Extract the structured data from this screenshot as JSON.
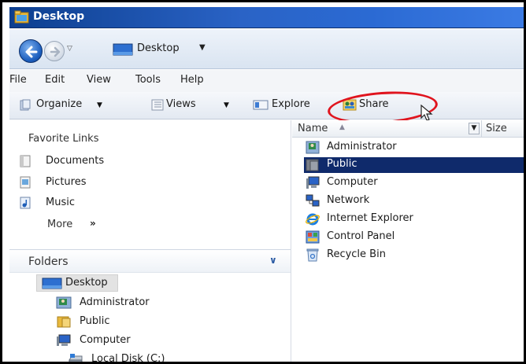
{
  "window": {
    "title": "Desktop"
  },
  "address": {
    "location": "Desktop"
  },
  "menu": [
    "File",
    "Edit",
    "View",
    "Tools",
    "Help"
  ],
  "toolbar": {
    "organize": "Organize",
    "views": "Views",
    "explore": "Explore",
    "share": "Share"
  },
  "favorites": {
    "title": "Favorite Links",
    "items": [
      "Documents",
      "Pictures",
      "Music"
    ],
    "more": "More",
    "more_arrows": "»"
  },
  "folders": {
    "title": "Folders",
    "tree": [
      "Desktop",
      "Administrator",
      "Public",
      "Computer",
      "Local Disk (C:)"
    ]
  },
  "filelist": {
    "columns": {
      "name": "Name",
      "size": "Size"
    },
    "items": [
      "Administrator",
      "Public",
      "Computer",
      "Network",
      "Internet Explorer",
      "Control Panel",
      "Recycle Bin"
    ],
    "selected": "Public"
  },
  "colors": {
    "titlebar": "#2a63c6",
    "selection": "#0f2a6b",
    "annotation": "#e0141e"
  }
}
